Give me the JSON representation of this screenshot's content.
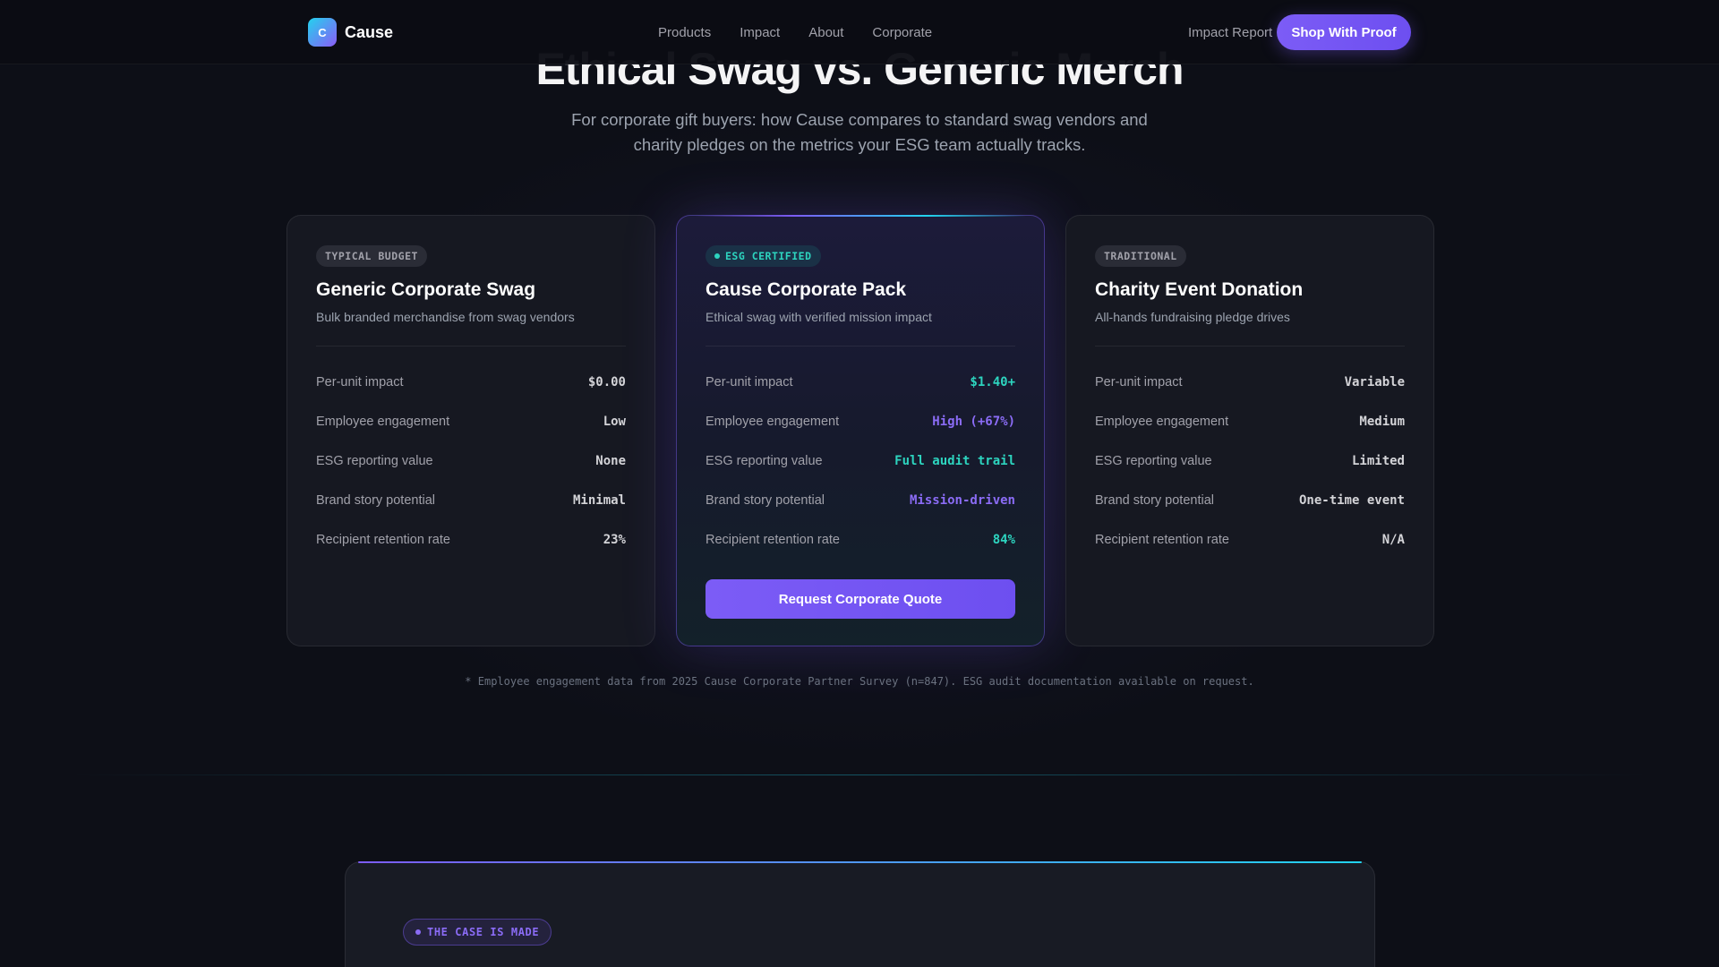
{
  "nav": {
    "brand": "Cause",
    "brand_initial": "C",
    "links": [
      "Products",
      "Impact",
      "About",
      "Corporate"
    ],
    "report_link": "Impact Report",
    "cta": "Shop With Proof"
  },
  "hero": {
    "title": "Ethical Swag vs. Generic Merch",
    "subtitle": "For corporate gift buyers: how Cause compares to standard swag vendors and charity pledges on the metrics your ESG team actually tracks."
  },
  "cards": [
    {
      "badge": "TYPICAL BUDGET",
      "title": "Generic Corporate Swag",
      "subtitle": "Bulk branded merchandise from swag vendors",
      "rows": [
        {
          "label": "Per-unit impact",
          "value": "$0.00"
        },
        {
          "label": "Employee engagement",
          "value": "Low"
        },
        {
          "label": "ESG reporting value",
          "value": "None"
        },
        {
          "label": "Brand story potential",
          "value": "Minimal"
        },
        {
          "label": "Recipient retention rate",
          "value": "23%"
        }
      ]
    },
    {
      "badge": "ESG CERTIFIED",
      "title": "Cause Corporate Pack",
      "subtitle": "Ethical swag with verified mission impact",
      "rows": [
        {
          "label": "Per-unit impact",
          "value": "$1.40+"
        },
        {
          "label": "Employee engagement",
          "value": "High (+67%)"
        },
        {
          "label": "ESG reporting value",
          "value": "Full audit trail"
        },
        {
          "label": "Brand story potential",
          "value": "Mission-driven"
        },
        {
          "label": "Recipient retention rate",
          "value": "84%"
        }
      ],
      "cta": "Request Corporate Quote"
    },
    {
      "badge": "TRADITIONAL",
      "title": "Charity Event Donation",
      "subtitle": "All-hands fundraising pledge drives",
      "rows": [
        {
          "label": "Per-unit impact",
          "value": "Variable"
        },
        {
          "label": "Employee engagement",
          "value": "Medium"
        },
        {
          "label": "ESG reporting value",
          "value": "Limited"
        },
        {
          "label": "Brand story potential",
          "value": "One-time event"
        },
        {
          "label": "Recipient retention rate",
          "value": "N/A"
        }
      ]
    }
  ],
  "footnote": "* Employee engagement data from 2025 Cause Corporate Partner Survey (n=847). ESG audit documentation available on request.",
  "case": {
    "badge": "THE CASE IS MADE"
  },
  "colors": {
    "accent_purple": "#7c5cf6",
    "accent_teal": "#2dd4bf",
    "background": "#0d0f17"
  }
}
